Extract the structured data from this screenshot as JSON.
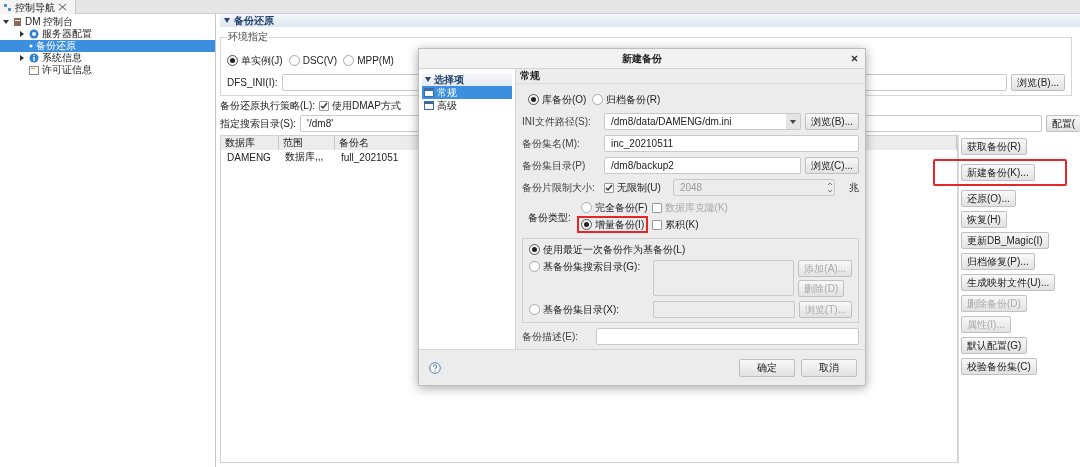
{
  "nav_tab": {
    "title": "控制导航"
  },
  "nav_tree": [
    {
      "label": "DM 控制台",
      "expanded": true,
      "selected": false,
      "children": [
        {
          "label": "服务器配置",
          "expanded": false,
          "selected": false
        },
        {
          "label": "备份还原",
          "selected": true
        },
        {
          "label": "系统信息",
          "expanded": false,
          "selected": false
        },
        {
          "label": "许可证信息",
          "selected": false
        }
      ]
    }
  ],
  "section": {
    "title": "备份还原"
  },
  "environment": {
    "legend": "环境指定",
    "modes": [
      {
        "label": "单实例(J)",
        "selected": true
      },
      {
        "label": "DSC(V)",
        "selected": false
      },
      {
        "label": "MPP(M)",
        "selected": false
      }
    ],
    "dfs_label": "DFS_INI(I):",
    "browse": "浏览(B)..."
  },
  "strategy": {
    "label": "备份还原执行策略(L):",
    "option": "使用DMAP方式",
    "checked": true
  },
  "search_dir": {
    "label": "指定搜索目录(S):",
    "value": "'/dm8'",
    "button": "配置("
  },
  "table": {
    "columns": [
      "数据库",
      "范围",
      "备份名"
    ],
    "rows": [
      [
        "DAMENG",
        "数据库,,,",
        "full_2021051"
      ]
    ]
  },
  "actions": [
    {
      "label": "获取备份(R)",
      "disabled": false,
      "highlighted": false
    },
    {
      "label": "新建备份(K)...",
      "disabled": false,
      "highlighted": true
    },
    {
      "label": "还原(O)...",
      "disabled": false,
      "highlighted": false
    },
    {
      "label": "恢复(H)",
      "disabled": false,
      "highlighted": false
    },
    {
      "label": "更新DB_Magic(I)",
      "disabled": false,
      "highlighted": false
    },
    {
      "label": "归档修复(P)...",
      "disabled": false,
      "highlighted": false
    },
    {
      "label": "生成映射文件(U)...",
      "disabled": false,
      "highlighted": false
    },
    {
      "label": "删除备份(D)",
      "disabled": true,
      "highlighted": false
    },
    {
      "label": "属性(I)...",
      "disabled": true,
      "highlighted": false
    },
    {
      "label": "默认配置(G)",
      "disabled": false,
      "highlighted": false
    },
    {
      "label": "校验备份集(C)",
      "disabled": false,
      "highlighted": false
    }
  ],
  "dialog": {
    "title": "新建备份",
    "options_header": "选择项",
    "options": [
      {
        "label": "常规",
        "selected": true
      },
      {
        "label": "高级",
        "selected": false
      }
    ],
    "page_title": "常规",
    "backup_modes": [
      {
        "label": "库备份(O)",
        "selected": true
      },
      {
        "label": "归档备份(R)",
        "selected": false
      }
    ],
    "ini_label": "INI文件路径(S):",
    "ini_value": "/dm8/data/DAMENG/dm.ini",
    "ini_browse": "浏览(B)...",
    "name_label": "备份集名(M):",
    "name_value": "inc_20210511",
    "dir_label": "备份集目录(P)",
    "dir_value": "/dm8/backup2",
    "dir_browse": "浏览(C)...",
    "piece_label": "备份片限制大小:",
    "unlimited": {
      "label": "无限制(U)",
      "checked": true
    },
    "piece_value": "2048",
    "piece_unit": "兆",
    "type_label": "备份类型:",
    "types": [
      {
        "label": "完全备份(F)",
        "selected": false,
        "highlighted": false,
        "option": {
          "label": "数据库克隆(K)",
          "checked": false,
          "disabled": true
        }
      },
      {
        "label": "增量备份(I)",
        "selected": true,
        "highlighted": true,
        "option": {
          "label": "累积(K)",
          "checked": false,
          "disabled": false
        }
      }
    ],
    "base_latest": {
      "label": "使用最近一次备份作为基备份(L)",
      "selected": true
    },
    "base_search": {
      "label": "基备份集搜索目录(G):",
      "selected": false,
      "add": "添加(A)...",
      "remove": "删除(D)",
      "disabled": true
    },
    "base_dir": {
      "label": "基备份集目录(X):",
      "selected": false,
      "browse": "浏览(T)...",
      "disabled": true
    },
    "desc_label": "备份描述(E):",
    "ok": "确定",
    "cancel": "取消"
  }
}
